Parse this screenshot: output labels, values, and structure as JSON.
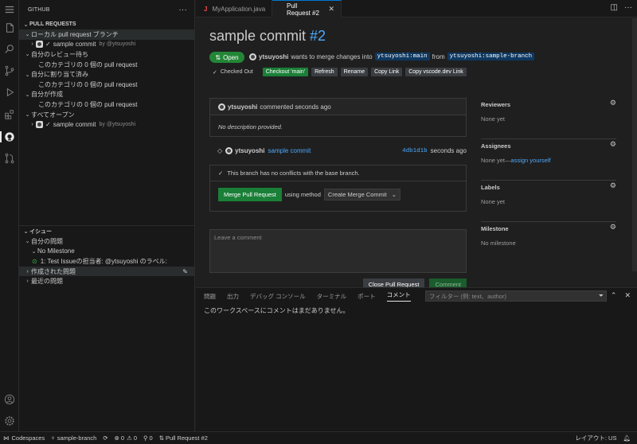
{
  "sidebar": {
    "title": "GITHUB",
    "pull_requests_header": "PULL REQUESTS",
    "pr_tree": [
      {
        "label": "ローカル pull request ブランチ",
        "expanded": true
      },
      {
        "label": "sample commit",
        "meta": "by @ytsuyoshi"
      },
      {
        "label": "自分のレビュー待ち"
      },
      {
        "label": "このカテゴリの 0 個の pull request"
      },
      {
        "label": "自分に割り当て済み"
      },
      {
        "label": "このカテゴリの 0 個の pull request"
      },
      {
        "label": "自分が作成"
      },
      {
        "label": "このカテゴリの 0 個の pull request"
      },
      {
        "label": "すべてオープン"
      },
      {
        "label": "sample commit",
        "meta": "by @ytsuyoshi"
      }
    ],
    "issues_header": "イシュー",
    "issue_tree": [
      {
        "label": "自分の問題"
      },
      {
        "label": "No Milestone"
      },
      {
        "label": "1: Test Issueの担当者: @ytsuyoshi のラベル:"
      },
      {
        "label": "作成された問題"
      },
      {
        "label": "最近の問題"
      }
    ]
  },
  "tabs": [
    {
      "label": "MyApplication.java",
      "icon": "J"
    },
    {
      "label": "Pull Request #2",
      "close": "✕"
    }
  ],
  "pr": {
    "title": "sample commit",
    "number": "#2",
    "state": "Open",
    "author": "ytsuyoshi",
    "wants_text": "wants to merge changes into",
    "target_branch": "ytsuyoshi:main",
    "from_text": "from",
    "source_branch": "ytsuyoshi:sample-branch",
    "checked_out": "Checked Out",
    "checkout_btn": "Checkout 'main'",
    "refresh_btn": "Refresh",
    "rename_btn": "Rename",
    "copy_link_btn": "Copy Link",
    "copy_vscode_btn": "Copy vscode.dev Link",
    "comment_author": "ytsuyoshi",
    "comment_meta": "commented seconds ago",
    "comment_body": "No description provided.",
    "commit_author": "ytsuyoshi",
    "commit_title": "sample commit",
    "commit_sha": "4db1d1b",
    "commit_time": "seconds ago",
    "no_conflicts": "This branch has no conflicts with the base branch.",
    "merge_btn": "Merge Pull Request",
    "using_method": "using method",
    "merge_method": "Create Merge Commit",
    "comment_placeholder": "Leave a comment",
    "close_btn": "Close Pull Request",
    "comment_btn": "Comment"
  },
  "meta": [
    {
      "title": "Reviewers",
      "value": "None yet"
    },
    {
      "title": "Assignees",
      "value": "None yet—",
      "link": "assign yourself"
    },
    {
      "title": "Labels",
      "value": "None yet"
    },
    {
      "title": "Milestone",
      "value": "No milestone"
    }
  ],
  "panel": {
    "tabs": [
      "問題",
      "出力",
      "デバッグ コンソール",
      "ターミナル",
      "ポート",
      "コメント"
    ],
    "active_tab": "コメント",
    "filter_placeholder": "フィルター (例: text、author)",
    "message": "このワークスペースにコメントはまだありません。"
  },
  "status": {
    "remote": "Codespaces",
    "branch": "sample-branch",
    "errors": "0",
    "warnings": "0",
    "ports": "0",
    "pr": "Pull Request #2",
    "layout": "レイアウト: US"
  },
  "colors": {
    "accent": "#0078d4",
    "open_badge": "#238636",
    "link": "#4daafc",
    "remote": "#16825d"
  }
}
